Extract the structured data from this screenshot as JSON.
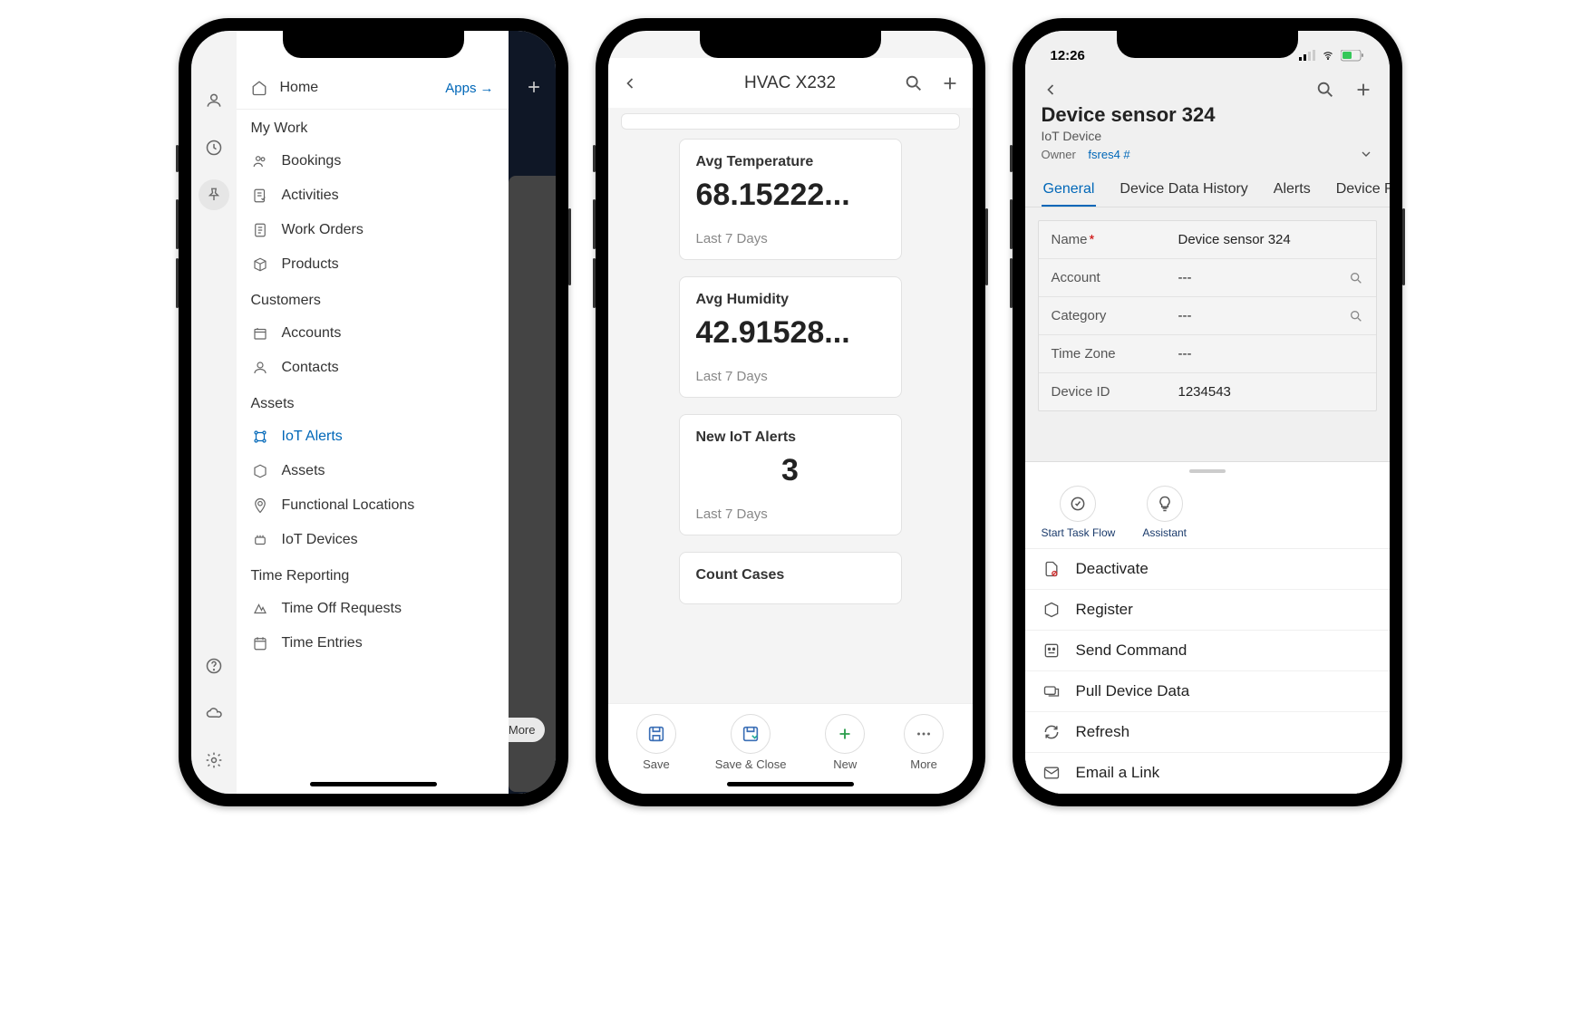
{
  "phone1": {
    "home_label": "Home",
    "apps_link": "Apps",
    "sections": {
      "my_work": "My Work",
      "customers": "Customers",
      "assets": "Assets",
      "time_reporting": "Time Reporting"
    },
    "items": {
      "bookings": "Bookings",
      "activities": "Activities",
      "work_orders": "Work Orders",
      "products": "Products",
      "accounts": "Accounts",
      "contacts": "Contacts",
      "iot_alerts": "IoT Alerts",
      "assets_item": "Assets",
      "functional_locations": "Functional Locations",
      "iot_devices": "IoT Devices",
      "time_off_requests": "Time Off Requests",
      "time_entries": "Time Entries"
    },
    "more_label": "More"
  },
  "phone2": {
    "title": "HVAC X232",
    "cards": [
      {
        "label": "Avg Temperature",
        "value": "68.15222...",
        "period": "Last 7 Days"
      },
      {
        "label": "Avg Humidity",
        "value": "42.91528...",
        "period": "Last 7 Days"
      },
      {
        "label": "New IoT Alerts",
        "value": "3",
        "period": "Last 7 Days"
      },
      {
        "label": "Count Cases",
        "value": "",
        "period": ""
      }
    ],
    "actions": {
      "save": "Save",
      "save_close": "Save & Close",
      "new": "New",
      "more": "More"
    }
  },
  "phone3": {
    "status_time": "12:26",
    "page_title": "Device sensor 324",
    "subtitle": "IoT Device",
    "owner_label": "Owner",
    "owner_value": "fsres4 #",
    "tabs": {
      "general": "General",
      "history": "Device Data History",
      "alerts": "Alerts",
      "device_r": "Device R"
    },
    "fields": {
      "name_label": "Name",
      "name_value": "Device sensor 324",
      "account_label": "Account",
      "account_value": "---",
      "category_label": "Category",
      "category_value": "---",
      "timezone_label": "Time Zone",
      "timezone_value": "---",
      "deviceid_label": "Device ID",
      "deviceid_value": "1234543"
    },
    "quick": {
      "start_task_flow": "Start Task Flow",
      "assistant": "Assistant"
    },
    "menu": {
      "deactivate": "Deactivate",
      "register": "Register",
      "send_command": "Send Command",
      "pull_device_data": "Pull Device Data",
      "refresh": "Refresh",
      "email_link": "Email a Link"
    }
  }
}
